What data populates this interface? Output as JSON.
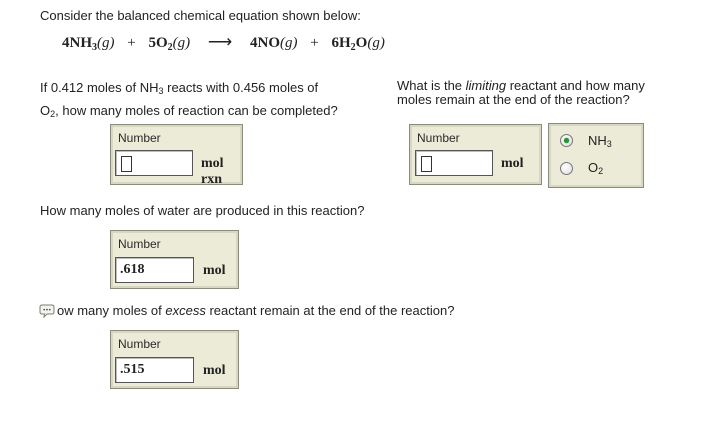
{
  "intro": "Consider the balanced chemical equation shown below:",
  "equation": {
    "reactant1": "4NH",
    "reactant1_sub": "3",
    "reactant1_state": "(g)",
    "plus1": "+",
    "reactant2": "5O",
    "reactant2_sub": "2",
    "reactant2_state": "(g)",
    "arrow": "⟶",
    "product1": "4NO",
    "product1_state": "(g)",
    "plus2": "+",
    "product2": "6H",
    "product2_sub": "2",
    "product2_mid": "O",
    "product2_state": "(g)"
  },
  "q1": {
    "line1_pre": "If 0.412 moles of NH",
    "line1_sub": "3",
    "line1_post": " reacts with 0.456 moles of",
    "line2_pre": "O",
    "line2_sub": "2",
    "line2_post": ", how many moles of reaction can be completed?",
    "box_label": "Number",
    "value": "",
    "unit": "mol rxn"
  },
  "q2": {
    "line1_pre": "What is the ",
    "line1_italic": "limiting",
    "line1_post": " reactant and how many",
    "line2": "moles remain at the end of the reaction?",
    "box_label": "Number",
    "value": "",
    "unit": "mol",
    "options": [
      {
        "base": "NH",
        "sub": "3",
        "selected": true
      },
      {
        "base": "O",
        "sub": "2",
        "selected": false
      }
    ]
  },
  "q3": {
    "text": "How many moles of water are produced in this reaction?",
    "box_label": "Number",
    "value": ".618",
    "unit": "mol"
  },
  "q4": {
    "text_pre": "ow many moles of ",
    "text_italic": "excess",
    "text_post": " reactant remain at the end of the reaction?",
    "box_label": "Number",
    "value": ".515",
    "unit": "mol"
  },
  "colors": {
    "radio_selected": "#1c9a2b",
    "box_bg": "#ecebd8"
  }
}
